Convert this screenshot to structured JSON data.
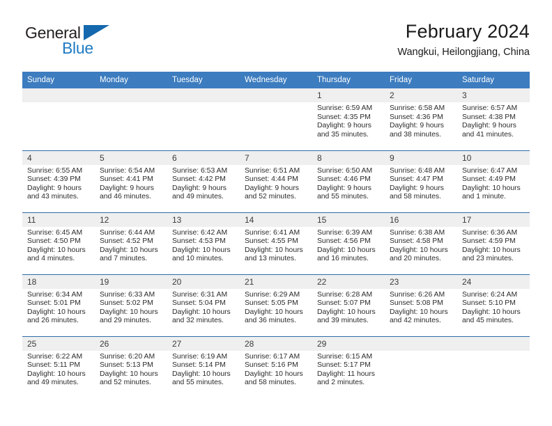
{
  "brand": {
    "name_part1": "General",
    "name_part2": "Blue"
  },
  "header": {
    "title": "February 2024",
    "subtitle": "Wangkui, Heilongjiang, China"
  },
  "weekday_headers": [
    "Sunday",
    "Monday",
    "Tuesday",
    "Wednesday",
    "Thursday",
    "Friday",
    "Saturday"
  ],
  "colors": {
    "header_blue": "#3c7cbf",
    "row_divider_blue": "#2e6ca8",
    "daynum_band": "#efefef",
    "logo_blue": "#1f7cc4"
  },
  "weeks": [
    [
      {
        "day": "",
        "empty": true
      },
      {
        "day": "",
        "empty": true
      },
      {
        "day": "",
        "empty": true
      },
      {
        "day": "",
        "empty": true
      },
      {
        "day": "1",
        "sunrise": "Sunrise: 6:59 AM",
        "sunset": "Sunset: 4:35 PM",
        "daylight_line1": "Daylight: 9 hours",
        "daylight_line2": "and 35 minutes."
      },
      {
        "day": "2",
        "sunrise": "Sunrise: 6:58 AM",
        "sunset": "Sunset: 4:36 PM",
        "daylight_line1": "Daylight: 9 hours",
        "daylight_line2": "and 38 minutes."
      },
      {
        "day": "3",
        "sunrise": "Sunrise: 6:57 AM",
        "sunset": "Sunset: 4:38 PM",
        "daylight_line1": "Daylight: 9 hours",
        "daylight_line2": "and 41 minutes."
      }
    ],
    [
      {
        "day": "4",
        "sunrise": "Sunrise: 6:55 AM",
        "sunset": "Sunset: 4:39 PM",
        "daylight_line1": "Daylight: 9 hours",
        "daylight_line2": "and 43 minutes."
      },
      {
        "day": "5",
        "sunrise": "Sunrise: 6:54 AM",
        "sunset": "Sunset: 4:41 PM",
        "daylight_line1": "Daylight: 9 hours",
        "daylight_line2": "and 46 minutes."
      },
      {
        "day": "6",
        "sunrise": "Sunrise: 6:53 AM",
        "sunset": "Sunset: 4:42 PM",
        "daylight_line1": "Daylight: 9 hours",
        "daylight_line2": "and 49 minutes."
      },
      {
        "day": "7",
        "sunrise": "Sunrise: 6:51 AM",
        "sunset": "Sunset: 4:44 PM",
        "daylight_line1": "Daylight: 9 hours",
        "daylight_line2": "and 52 minutes."
      },
      {
        "day": "8",
        "sunrise": "Sunrise: 6:50 AM",
        "sunset": "Sunset: 4:46 PM",
        "daylight_line1": "Daylight: 9 hours",
        "daylight_line2": "and 55 minutes."
      },
      {
        "day": "9",
        "sunrise": "Sunrise: 6:48 AM",
        "sunset": "Sunset: 4:47 PM",
        "daylight_line1": "Daylight: 9 hours",
        "daylight_line2": "and 58 minutes."
      },
      {
        "day": "10",
        "sunrise": "Sunrise: 6:47 AM",
        "sunset": "Sunset: 4:49 PM",
        "daylight_line1": "Daylight: 10 hours",
        "daylight_line2": "and 1 minute."
      }
    ],
    [
      {
        "day": "11",
        "sunrise": "Sunrise: 6:45 AM",
        "sunset": "Sunset: 4:50 PM",
        "daylight_line1": "Daylight: 10 hours",
        "daylight_line2": "and 4 minutes."
      },
      {
        "day": "12",
        "sunrise": "Sunrise: 6:44 AM",
        "sunset": "Sunset: 4:52 PM",
        "daylight_line1": "Daylight: 10 hours",
        "daylight_line2": "and 7 minutes."
      },
      {
        "day": "13",
        "sunrise": "Sunrise: 6:42 AM",
        "sunset": "Sunset: 4:53 PM",
        "daylight_line1": "Daylight: 10 hours",
        "daylight_line2": "and 10 minutes."
      },
      {
        "day": "14",
        "sunrise": "Sunrise: 6:41 AM",
        "sunset": "Sunset: 4:55 PM",
        "daylight_line1": "Daylight: 10 hours",
        "daylight_line2": "and 13 minutes."
      },
      {
        "day": "15",
        "sunrise": "Sunrise: 6:39 AM",
        "sunset": "Sunset: 4:56 PM",
        "daylight_line1": "Daylight: 10 hours",
        "daylight_line2": "and 16 minutes."
      },
      {
        "day": "16",
        "sunrise": "Sunrise: 6:38 AM",
        "sunset": "Sunset: 4:58 PM",
        "daylight_line1": "Daylight: 10 hours",
        "daylight_line2": "and 20 minutes."
      },
      {
        "day": "17",
        "sunrise": "Sunrise: 6:36 AM",
        "sunset": "Sunset: 4:59 PM",
        "daylight_line1": "Daylight: 10 hours",
        "daylight_line2": "and 23 minutes."
      }
    ],
    [
      {
        "day": "18",
        "sunrise": "Sunrise: 6:34 AM",
        "sunset": "Sunset: 5:01 PM",
        "daylight_line1": "Daylight: 10 hours",
        "daylight_line2": "and 26 minutes."
      },
      {
        "day": "19",
        "sunrise": "Sunrise: 6:33 AM",
        "sunset": "Sunset: 5:02 PM",
        "daylight_line1": "Daylight: 10 hours",
        "daylight_line2": "and 29 minutes."
      },
      {
        "day": "20",
        "sunrise": "Sunrise: 6:31 AM",
        "sunset": "Sunset: 5:04 PM",
        "daylight_line1": "Daylight: 10 hours",
        "daylight_line2": "and 32 minutes."
      },
      {
        "day": "21",
        "sunrise": "Sunrise: 6:29 AM",
        "sunset": "Sunset: 5:05 PM",
        "daylight_line1": "Daylight: 10 hours",
        "daylight_line2": "and 36 minutes."
      },
      {
        "day": "22",
        "sunrise": "Sunrise: 6:28 AM",
        "sunset": "Sunset: 5:07 PM",
        "daylight_line1": "Daylight: 10 hours",
        "daylight_line2": "and 39 minutes."
      },
      {
        "day": "23",
        "sunrise": "Sunrise: 6:26 AM",
        "sunset": "Sunset: 5:08 PM",
        "daylight_line1": "Daylight: 10 hours",
        "daylight_line2": "and 42 minutes."
      },
      {
        "day": "24",
        "sunrise": "Sunrise: 6:24 AM",
        "sunset": "Sunset: 5:10 PM",
        "daylight_line1": "Daylight: 10 hours",
        "daylight_line2": "and 45 minutes."
      }
    ],
    [
      {
        "day": "25",
        "sunrise": "Sunrise: 6:22 AM",
        "sunset": "Sunset: 5:11 PM",
        "daylight_line1": "Daylight: 10 hours",
        "daylight_line2": "and 49 minutes."
      },
      {
        "day": "26",
        "sunrise": "Sunrise: 6:20 AM",
        "sunset": "Sunset: 5:13 PM",
        "daylight_line1": "Daylight: 10 hours",
        "daylight_line2": "and 52 minutes."
      },
      {
        "day": "27",
        "sunrise": "Sunrise: 6:19 AM",
        "sunset": "Sunset: 5:14 PM",
        "daylight_line1": "Daylight: 10 hours",
        "daylight_line2": "and 55 minutes."
      },
      {
        "day": "28",
        "sunrise": "Sunrise: 6:17 AM",
        "sunset": "Sunset: 5:16 PM",
        "daylight_line1": "Daylight: 10 hours",
        "daylight_line2": "and 58 minutes."
      },
      {
        "day": "29",
        "sunrise": "Sunrise: 6:15 AM",
        "sunset": "Sunset: 5:17 PM",
        "daylight_line1": "Daylight: 11 hours",
        "daylight_line2": "and 2 minutes."
      },
      {
        "day": "",
        "empty": true
      },
      {
        "day": "",
        "empty": true
      }
    ]
  ]
}
